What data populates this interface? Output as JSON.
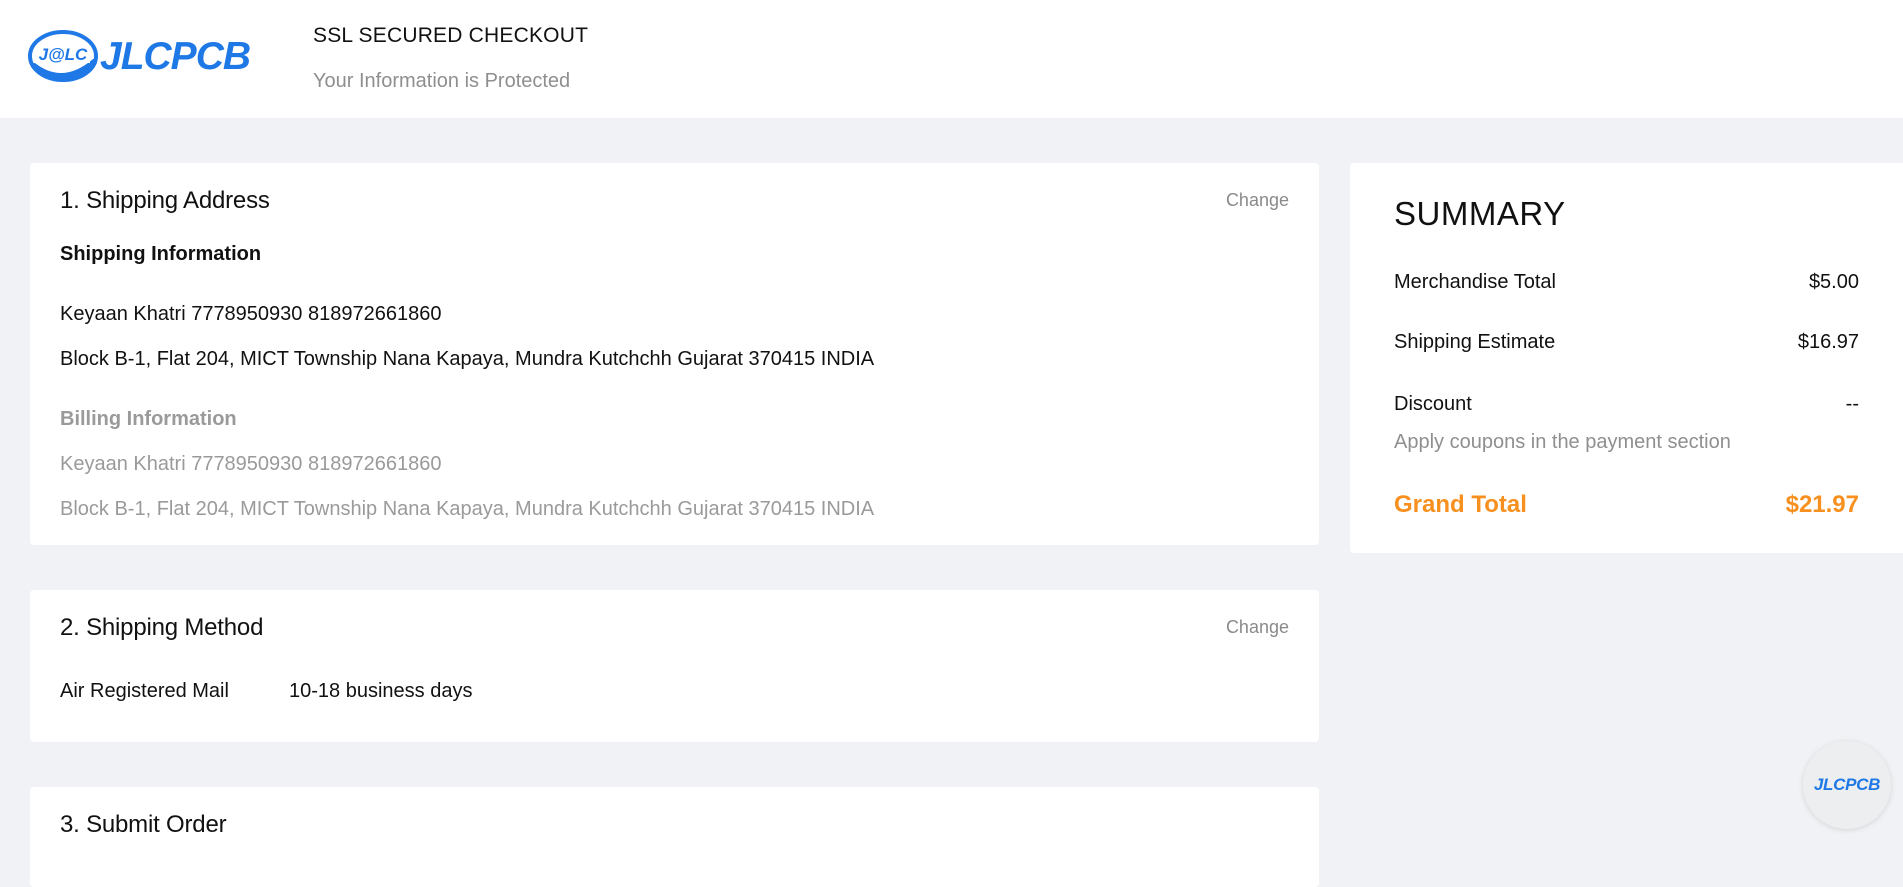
{
  "header": {
    "logo_mark_text": "J@LC",
    "logo_word": "JLCPCB",
    "title": "SSL SECURED CHECKOUT",
    "subtitle": "Your Information is Protected"
  },
  "shipping_address": {
    "title": "1. Shipping Address",
    "change_label": "Change",
    "shipping_heading": "Shipping Information",
    "shipping_name_phone": "Keyaan Khatri 7778950930 818972661860",
    "shipping_address": "Block B-1, Flat 204, MICT Township Nana Kapaya, Mundra Kutchchh Gujarat 370415 INDIA",
    "billing_heading": "Billing Information",
    "billing_name_phone": "Keyaan Khatri 7778950930 818972661860",
    "billing_address": "Block B-1, Flat 204, MICT Township Nana Kapaya, Mundra Kutchchh Gujarat 370415 INDIA"
  },
  "shipping_method": {
    "title": "2. Shipping Method",
    "change_label": "Change",
    "method_name": "Air Registered Mail",
    "delivery_time": "10-18 business days"
  },
  "submit_order": {
    "title": "3. Submit Order"
  },
  "summary": {
    "title": "SUMMARY",
    "merchandise_label": "Merchandise Total",
    "merchandise_value": "$5.00",
    "shipping_label": "Shipping Estimate",
    "shipping_value": "$16.97",
    "discount_label": "Discount",
    "discount_value": "--",
    "discount_note": "Apply coupons in the payment section",
    "grand_total_label": "Grand Total",
    "grand_total_value": "$21.97"
  },
  "chat_button": {
    "label": "JLCPCB"
  },
  "colors": {
    "brand_blue": "#1e78e6",
    "accent_orange": "#f7901e",
    "page_background": "#f0f2f5"
  }
}
